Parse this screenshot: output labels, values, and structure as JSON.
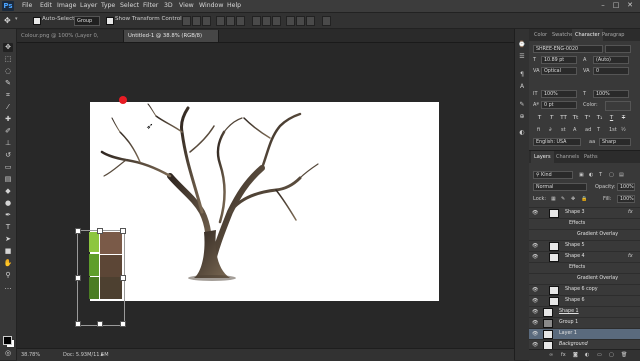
{
  "menubar": {
    "logo": "Ps",
    "items": [
      "File",
      "Edit",
      "Image",
      "Layer",
      "Type",
      "Select",
      "Filter",
      "3D",
      "View",
      "Window",
      "Help"
    ]
  },
  "options": {
    "auto_select_label": "Auto-Select:",
    "auto_select_value": "Group",
    "transform_label": "Show Transform Controls"
  },
  "tabs": [
    {
      "label": "Colour.png @ 100% (Layer 0, RGB/8)",
      "active": false
    },
    {
      "label": "Untitled-1 @ 38.8% (RGB/8) *",
      "active": true
    }
  ],
  "status": {
    "zoom": "38.78%",
    "doc": "Doc: 5.93M/11.5M"
  },
  "character": {
    "tabs": [
      "Color",
      "Swatches",
      "Character",
      "Paragrap"
    ],
    "font": "SHREE-ENG-0020",
    "size": "10.89 pt",
    "leading": "(Auto)",
    "kerning": "Optical",
    "tracking": "0",
    "vscale": "100%",
    "hscale": "100%",
    "baseline": "0 pt",
    "color_label": "Color:",
    "style_buttons": [
      "T",
      "T",
      "TT",
      "Tt",
      "T¹",
      "T₁",
      "T",
      "T"
    ],
    "language": "English: USA",
    "antialias": "Sharp"
  },
  "layers": {
    "tabs": [
      "Layers",
      "Channels",
      "Paths"
    ],
    "kind": "Kind",
    "blend": "Normal",
    "opacity_label": "Opacity:",
    "opacity": "100%",
    "lock_label": "Lock:",
    "fill_label": "Fill:",
    "fill": "100%",
    "rows": [
      {
        "name": "Shape 3",
        "fx": true,
        "indent": 1,
        "selected": false
      },
      {
        "name": "Effects",
        "indent": 2,
        "selected": false,
        "effect": true
      },
      {
        "name": "Gradient Overlay",
        "indent": 3,
        "selected": false,
        "effect": true
      },
      {
        "name": "Shape 5",
        "indent": 1,
        "selected": false
      },
      {
        "name": "Shape 4",
        "fx": true,
        "indent": 1,
        "selected": false
      },
      {
        "name": "Effects",
        "indent": 2,
        "selected": false,
        "effect": true
      },
      {
        "name": "Gradient Overlay",
        "indent": 3,
        "selected": false,
        "effect": true
      },
      {
        "name": "Shape 6 copy",
        "indent": 1,
        "selected": false
      },
      {
        "name": "Shape 6",
        "indent": 1,
        "selected": false
      },
      {
        "name": "Shape 1",
        "indent": 0,
        "selected": false,
        "underline": true
      },
      {
        "name": "Group 1",
        "indent": 0,
        "selected": false,
        "group": true
      },
      {
        "name": "Layer 1",
        "indent": 0,
        "selected": true
      },
      {
        "name": "Background",
        "indent": 0,
        "selected": false,
        "italic": true
      }
    ]
  },
  "swatches": {
    "left_colors": [
      "#8dc63f",
      "#5f9e2b",
      "#4b7d23"
    ],
    "right_colors": [
      "#7a5a48",
      "#5c4636",
      "#4d4030"
    ]
  },
  "colors": {
    "accent_red": "#e81c24",
    "bark_dark": "#3b3128",
    "bark_light": "#7a6a52"
  }
}
